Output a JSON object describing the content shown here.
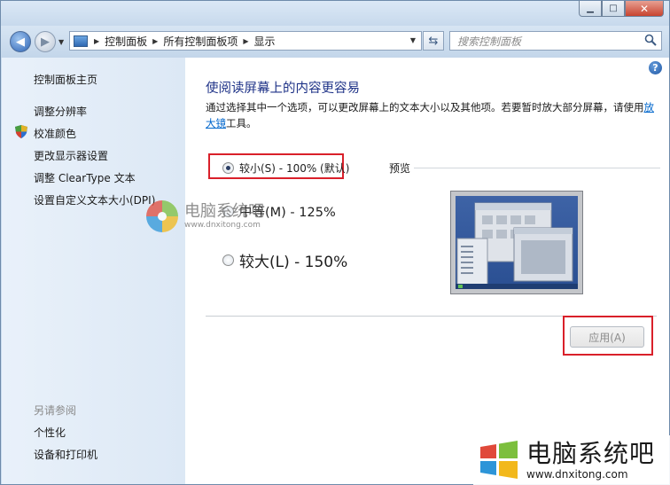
{
  "window": {
    "minimize_glyph": "▁",
    "maximize_glyph": "□",
    "close_glyph": "✕"
  },
  "toolbar": {
    "breadcrumbs": [
      "控制面板",
      "所有控制面板项",
      "显示"
    ],
    "search_placeholder": "搜索控制面板"
  },
  "sidebar": {
    "home": "控制面板主页",
    "links": [
      "调整分辨率",
      "校准颜色",
      "更改显示器设置",
      "调整 ClearType 文本",
      "设置自定义文本大小(DPI)"
    ],
    "see_also_heading": "另请参阅",
    "see_also": [
      "个性化",
      "设备和打印机"
    ]
  },
  "main": {
    "title": "使阅读屏幕上的内容更容易",
    "description_before": "通过选择其中一个选项，可以更改屏幕上的文本大小以及其他项。若要暂时放大部分屏幕，请使用",
    "description_link": "放大镜",
    "description_after": "工具。",
    "options": [
      {
        "label": "较小(S) - 100% (默认)",
        "checked": true
      },
      {
        "label": "中等(M) - 125%",
        "checked": false
      },
      {
        "label": "较大(L) - 150%",
        "checked": false
      }
    ],
    "preview_label": "预览",
    "apply_label": "应用(A)",
    "help_glyph": "?"
  },
  "watermark": {
    "title": "电脑系统吧",
    "url": "www.dnxitong.com"
  },
  "colors": {
    "title": "#1e3287",
    "link": "#0066cc",
    "highlight_box": "#d9202a"
  }
}
